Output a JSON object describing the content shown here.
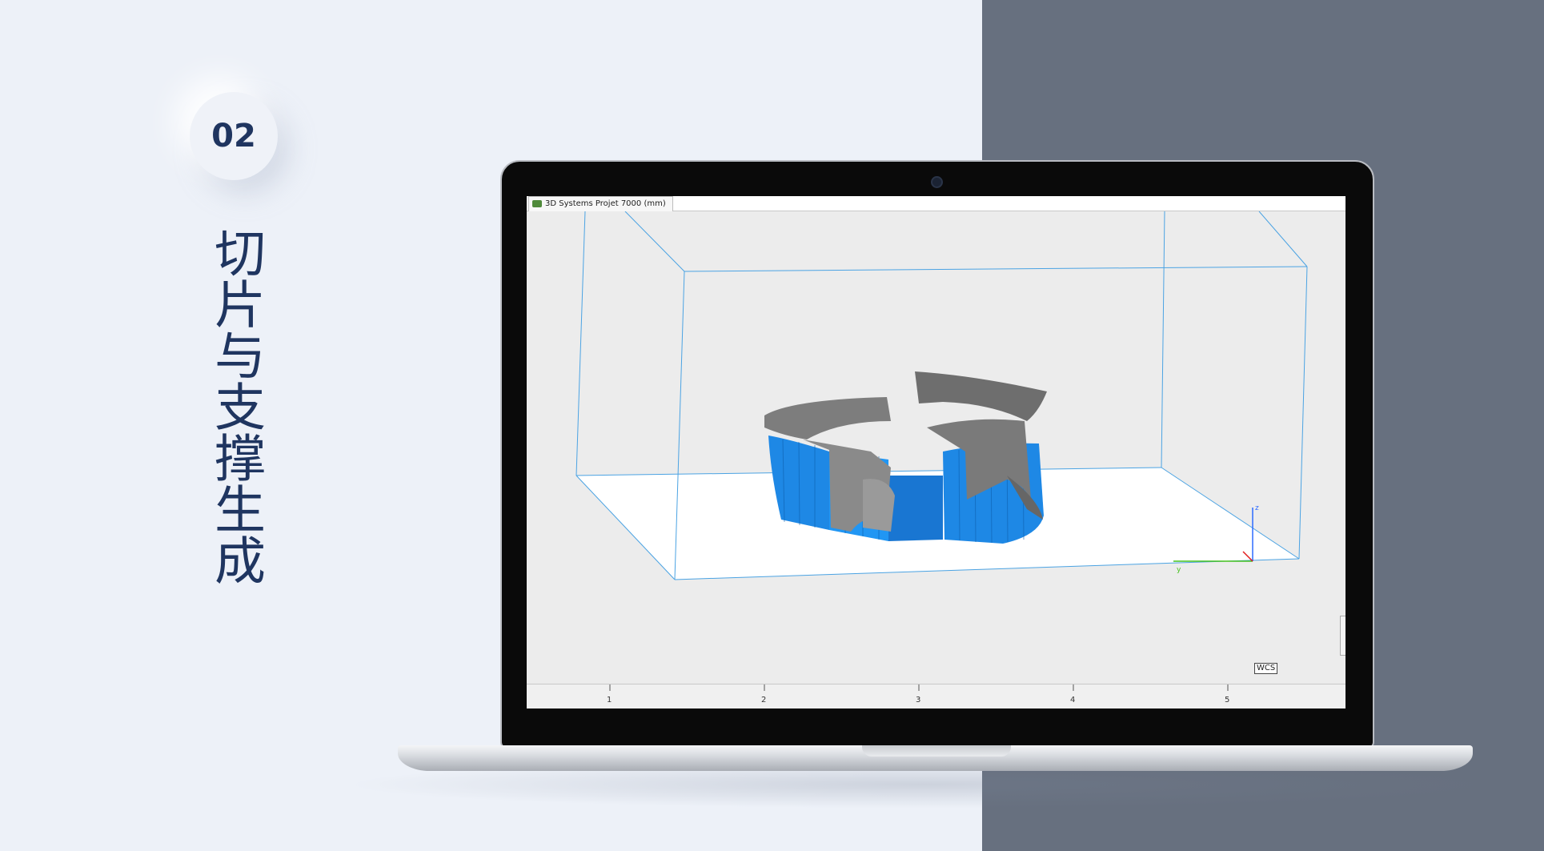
{
  "slide": {
    "number": "02",
    "title": "切片与支撑生成"
  },
  "app": {
    "tab_label": "3D Systems Projet 7000 (mm)",
    "triad_z": "z",
    "triad_y": "y",
    "wcs_label": "WCS",
    "ruler_ticks": [
      "1",
      "2",
      "3",
      "4",
      "5"
    ]
  },
  "colors": {
    "title_text": "#1f3560",
    "left_background": "#edf1f8",
    "right_panel": "#67707f",
    "build_box_edge": "#4ba3e3",
    "support_blue": "#1e88e5",
    "part_gray": "#7a7a7a"
  },
  "icons": [
    "app-icon",
    "triad-icon"
  ]
}
